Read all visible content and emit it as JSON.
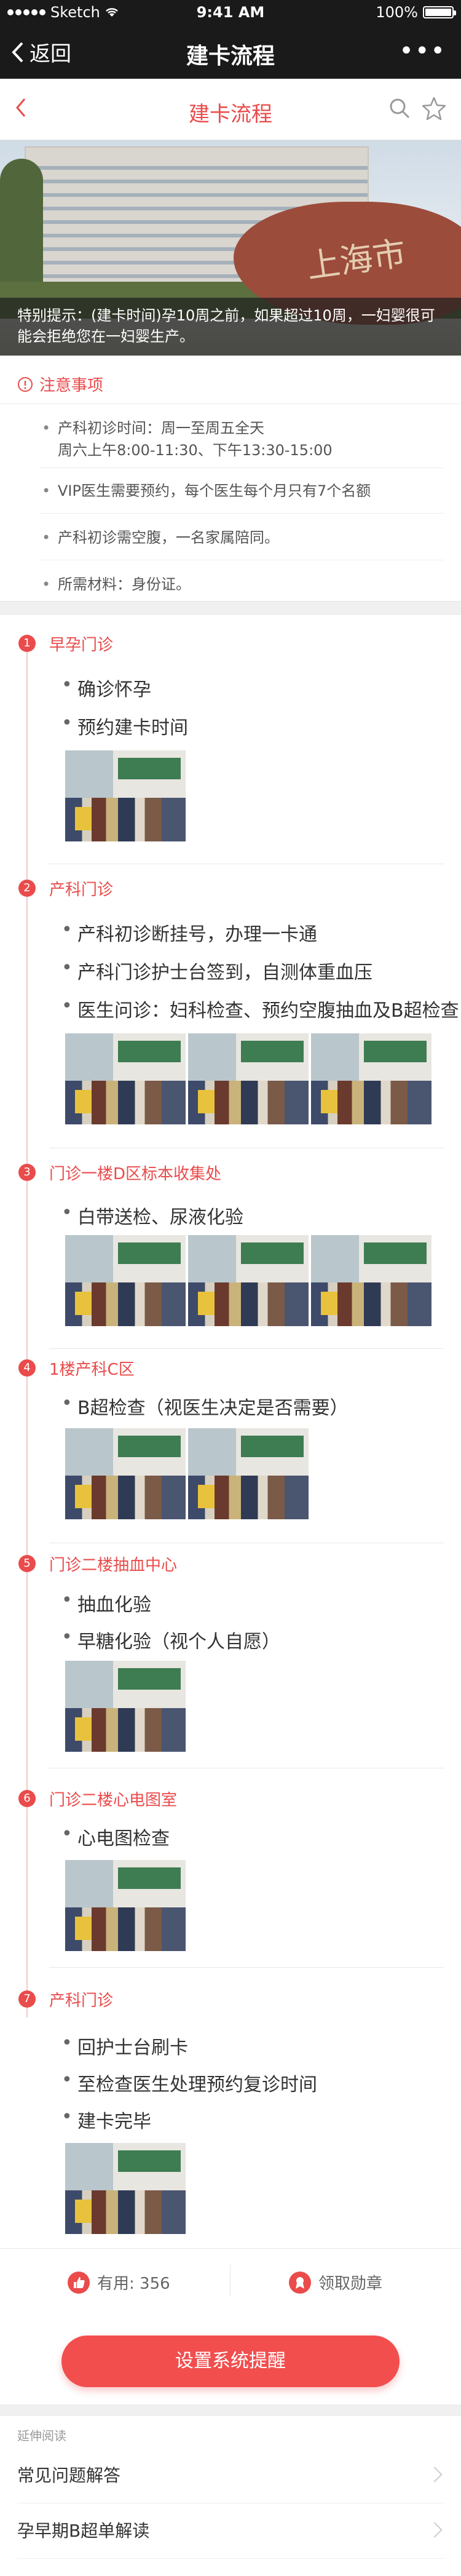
{
  "status_bar": {
    "carrier": "Sketch",
    "time": "9:41 AM",
    "battery": "100%",
    "battery_level": 1.0
  },
  "nav": {
    "back_label": "返回",
    "title": "建卡流程",
    "more": "•••"
  },
  "page_header": {
    "title": "建卡流程"
  },
  "hero": {
    "rock_text": "上海市",
    "notice": "特别提示：(建卡时间)孕10周之前，如果超过10周，一妇婴很可能会拒绝您在一妇婴生产。"
  },
  "notes": {
    "heading": "注意事项",
    "items": [
      {
        "line1": "产科初诊时间：周一至周五全天",
        "line2": "周六上午8:00-11:30、下午13:30-15:00"
      },
      {
        "line1": "VIP医生需要预约，每个医生每个月只有7个名额"
      },
      {
        "line1": "产科初诊需空腹，一名家属陪同。"
      },
      {
        "line1": "所需材料：身份证。"
      }
    ]
  },
  "steps": [
    {
      "num": "1",
      "title": "早孕门诊",
      "items": [
        "确诊怀孕",
        "预约建卡时间"
      ]
    },
    {
      "num": "2",
      "title": "产科门诊",
      "items": [
        "产科初诊断挂号，办理一卡通",
        "产科门诊护士台签到，自测体重血压",
        "医生问诊：妇科检查、预约空腹抽血及B超检查"
      ]
    },
    {
      "num": "3",
      "title": "门诊一楼D区标本收集处",
      "items": [
        "白带送检、尿液化验"
      ]
    },
    {
      "num": "4",
      "title": "1楼产科C区",
      "items": [
        "B超检查（视医生决定是否需要）"
      ]
    },
    {
      "num": "5",
      "title": "门诊二楼抽血中心",
      "items": [
        "抽血化验",
        "早糖化验（视个人自愿）"
      ]
    },
    {
      "num": "6",
      "title": "门诊二楼心电图室",
      "items": [
        "心电图检查"
      ]
    },
    {
      "num": "7",
      "title": "产科门诊",
      "items": [
        "回护士台刷卡",
        "至检查医生处理预约复诊时间",
        "建卡完毕"
      ]
    }
  ],
  "actions": {
    "useful_label": "有用: 356",
    "badge_label": "领取勋章"
  },
  "remind_button": "设置系统提醒",
  "further": {
    "label": "延伸阅读",
    "items": [
      "常见问题解答",
      "孕早期B超单解读"
    ]
  },
  "colors": {
    "accent": "#ea4b4b",
    "dark_bar": "#1a1a1a"
  }
}
